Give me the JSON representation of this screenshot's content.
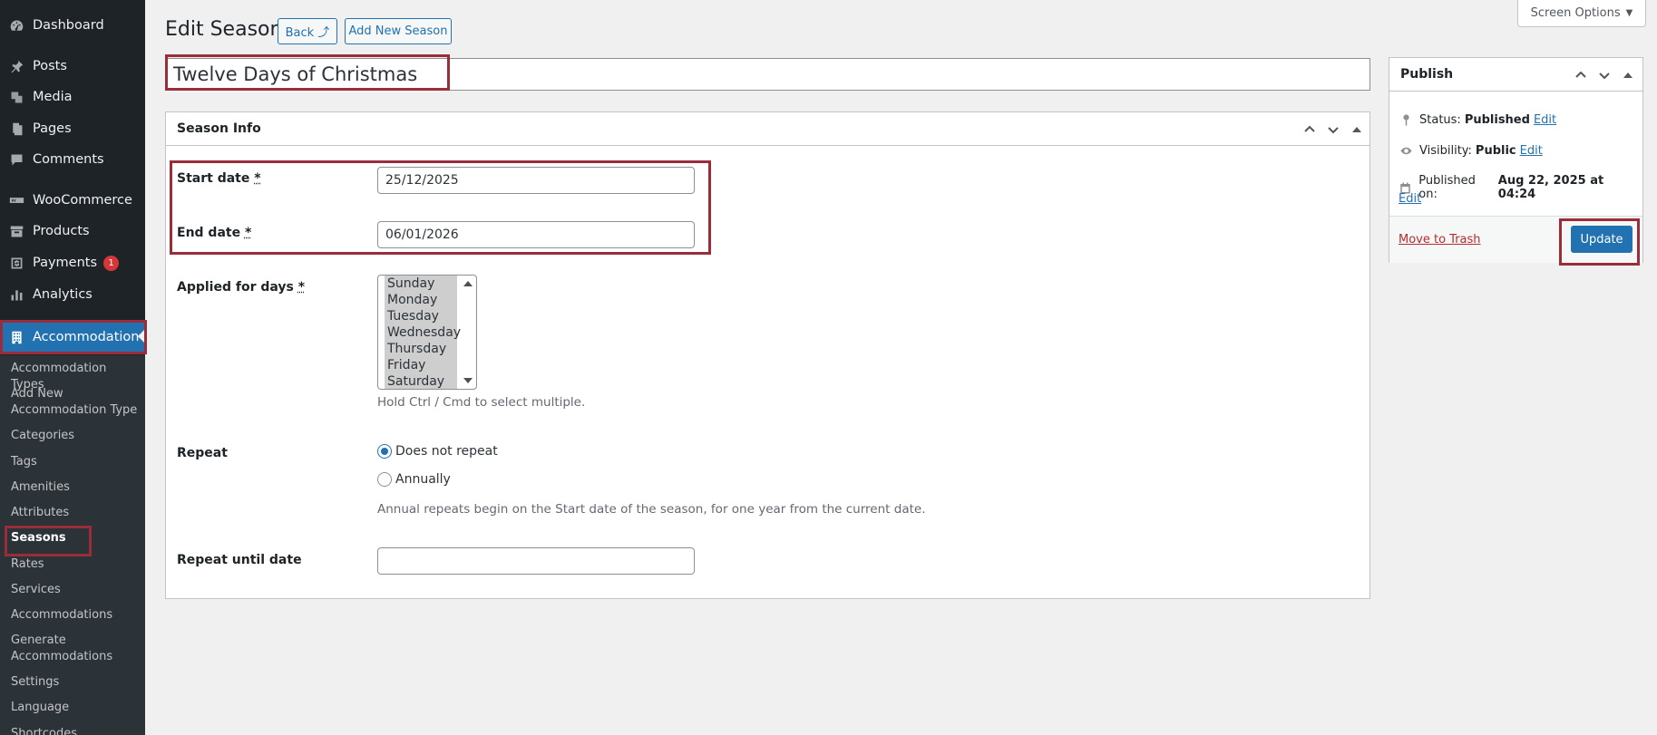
{
  "sidebar": {
    "items": [
      {
        "label": "Dashboard",
        "icon": "dashboard-icon"
      },
      {
        "label": "Posts",
        "icon": "pin-icon"
      },
      {
        "label": "Media",
        "icon": "media-icon"
      },
      {
        "label": "Pages",
        "icon": "pages-icon"
      },
      {
        "label": "Comments",
        "icon": "comment-icon"
      },
      {
        "label": "WooCommerce",
        "icon": "woo-icon"
      },
      {
        "label": "Products",
        "icon": "archive-icon"
      },
      {
        "label": "Payments",
        "icon": "dollar-icon",
        "badge": "1"
      },
      {
        "label": "Analytics",
        "icon": "bar-chart-icon"
      },
      {
        "label": "Accommodation",
        "icon": "building-icon"
      }
    ],
    "submenu": [
      "Accommodation Types",
      "Add New Accommodation Type",
      "Categories",
      "Tags",
      "Amenities",
      "Attributes",
      "Seasons",
      "Rates",
      "Services",
      "Accommodations",
      "Generate Accommodations",
      "Settings",
      "Language",
      "Shortcodes"
    ]
  },
  "header": {
    "title": "Edit Season",
    "back_label": "Back ⤴",
    "add_new_label": "Add New Season",
    "screen_options_label": "Screen Options"
  },
  "post": {
    "title": "Twelve Days of Christmas"
  },
  "season_info": {
    "title": "Season Info",
    "start_date_label": "Start date",
    "start_date_value": "25/12/2025",
    "end_date_label": "End date",
    "end_date_value": "06/01/2026",
    "required_mark": "*",
    "days_label": "Applied for days",
    "days": [
      "Sunday",
      "Monday",
      "Tuesday",
      "Wednesday",
      "Thursday",
      "Friday",
      "Saturday"
    ],
    "days_help": "Hold Ctrl / Cmd to select multiple.",
    "repeat_label": "Repeat",
    "repeat_options": [
      "Does not repeat",
      "Annually"
    ],
    "repeat_selected": "Does not repeat",
    "repeat_help": "Annual repeats begin on the Start date of the season, for one year from the current date.",
    "repeat_until_label": "Repeat until date",
    "repeat_until_value": ""
  },
  "publish": {
    "title": "Publish",
    "status_label": "Status:",
    "status_value": "Published",
    "visibility_label": "Visibility:",
    "visibility_value": "Public",
    "published_on_label": "Published on:",
    "published_on_value": "Aug 22, 2025 at 04:24",
    "edit_label": "Edit",
    "trash_label": "Move to Trash",
    "update_label": "Update"
  },
  "colors": {
    "accent": "#2271b1",
    "sidebar_bg": "#1d2327",
    "highlight": "#9b2c3a",
    "danger": "#b32d2e"
  }
}
